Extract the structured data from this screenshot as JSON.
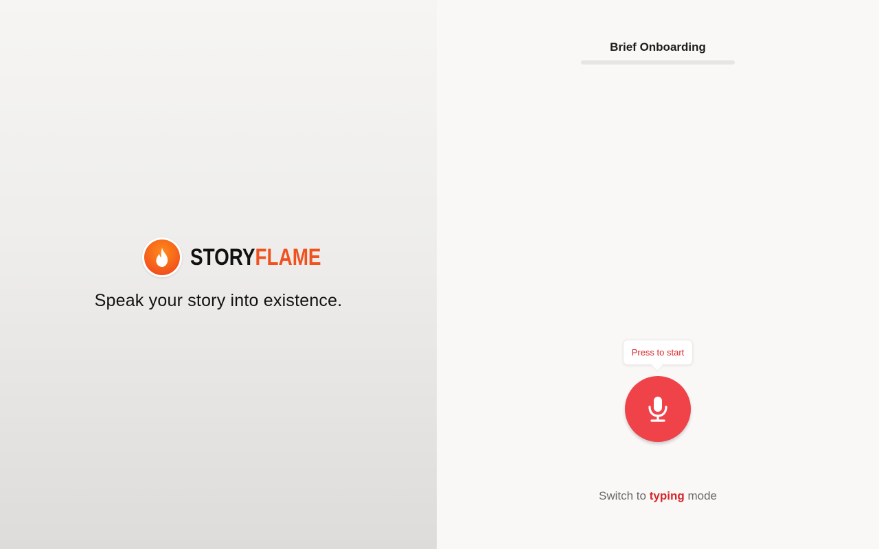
{
  "brand": {
    "name_part1": "Story",
    "name_part2": "Flame",
    "logo_icon": "flame-icon",
    "colors": {
      "dark": "#111111",
      "accent": "#f0521f"
    }
  },
  "tagline": "Speak your story into existence.",
  "onboarding": {
    "title": "Brief Onboarding",
    "progress": 0
  },
  "recorder": {
    "tooltip": "Press to start",
    "mic_icon": "microphone-icon",
    "button_color": "#ef4349"
  },
  "mode_switch": {
    "prefix": "Switch to",
    "link": "typing",
    "suffix": "mode",
    "link_color": "#d7262b"
  }
}
